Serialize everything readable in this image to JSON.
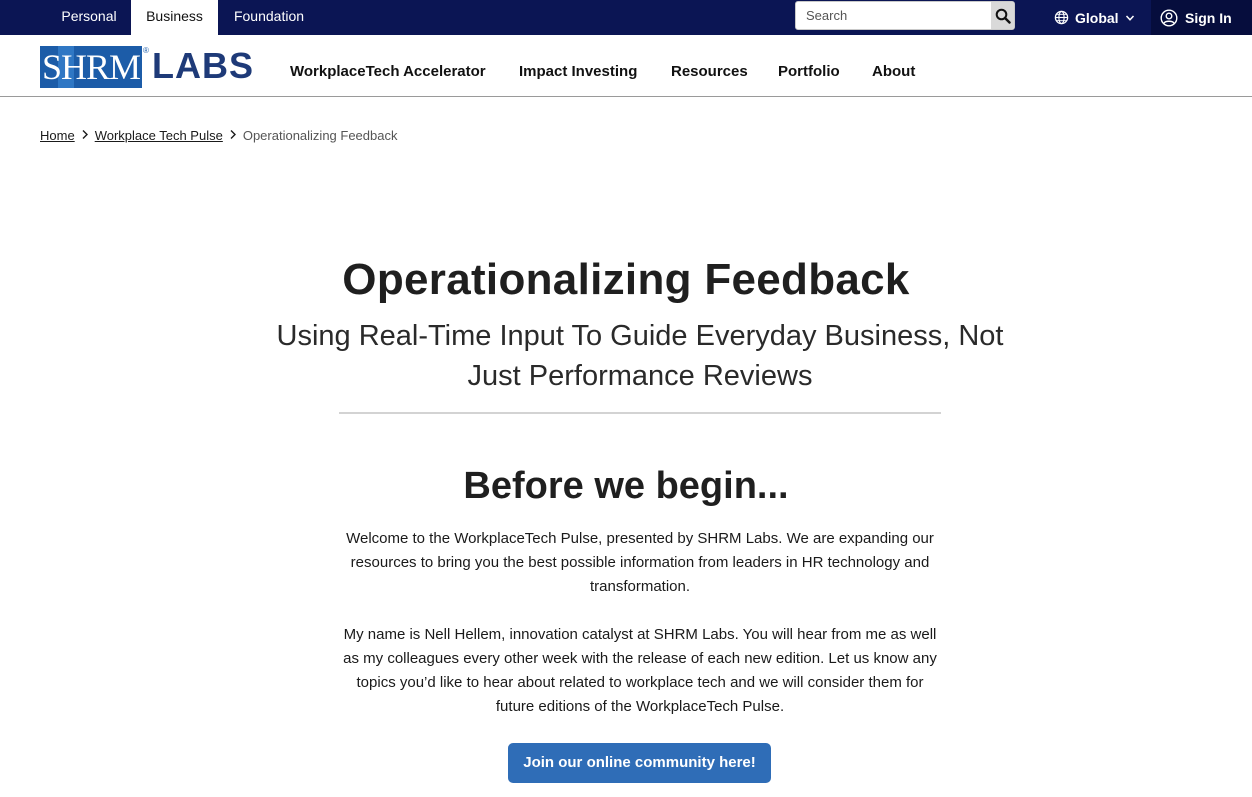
{
  "topbar": {
    "tabs": [
      {
        "label": "Personal",
        "active": false
      },
      {
        "label": "Business",
        "active": true
      },
      {
        "label": "Foundation",
        "active": false
      }
    ],
    "search": {
      "placeholder": "Search",
      "value": ""
    },
    "region_label": "Global",
    "signin_label": "Sign In"
  },
  "header": {
    "logo": {
      "left_text": "SHRM",
      "right_text": "LABS",
      "registered_mark": "®"
    },
    "nav": [
      {
        "label": "WorkplaceTech Accelerator"
      },
      {
        "label": "Impact Investing"
      },
      {
        "label": "Resources"
      },
      {
        "label": "Portfolio"
      },
      {
        "label": "About"
      }
    ]
  },
  "breadcrumb": {
    "items": [
      {
        "label": "Home"
      },
      {
        "label": "Workplace Tech Pulse"
      }
    ],
    "current": "Operationalizing Feedback"
  },
  "article": {
    "title": "Operationalizing Feedback",
    "subtitle": "Using Real-Time Input To Guide Everyday Business, Not Just Performance Reviews",
    "section_title": "Before we begin...",
    "paragraphs": [
      "Welcome to the WorkplaceTech Pulse, presented by SHRM Labs. We are expanding our resources to bring you the best possible information from leaders in HR technology and transformation.",
      "My name is Nell Hellem, innovation catalyst at SHRM Labs. You will hear from me as well as my colleagues every other week with the release of each new edition. Let us know any topics you’d like to hear about related to workplace tech and we will consider them for future editions of the WorkplaceTech Pulse."
    ],
    "cta_label": "Join our online community here!"
  },
  "colors": {
    "topbar_bg": "#0b1554",
    "signin_bg": "#060d3d",
    "logo_blue": "#1c5ca8",
    "logo_labs": "#1e3a78",
    "cta_bg": "#2f6db7"
  },
  "icons": {
    "search": "magnifier-icon",
    "region": "globe-icon",
    "region_caret": "chevron-down-icon",
    "account": "user-circle-icon",
    "breadcrumb_separator": "chevron-right-icon"
  }
}
